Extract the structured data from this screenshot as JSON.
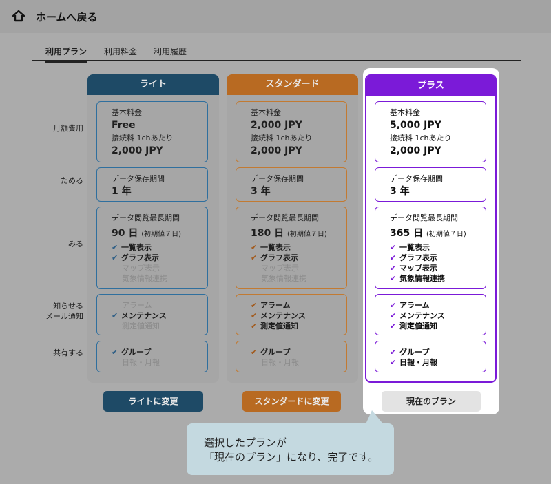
{
  "header": {
    "home_label": "ホームへ戻る"
  },
  "tabs": [
    {
      "label": "利用プラン",
      "active": true
    },
    {
      "label": "利用料金",
      "active": false
    },
    {
      "label": "利用履歴",
      "active": false
    }
  ],
  "row_labels": {
    "monthly_fee": "月額費用",
    "store": "ためる",
    "view": "みる",
    "notify_line1": "知らせる",
    "notify_line2": "メール通知",
    "share": "共有する"
  },
  "common": {
    "base_fee_label": "基本料金",
    "per_channel_label": "接続料 1chあたり",
    "retention_label": "データ保存期間",
    "view_period_label": "データ閲覧最長期間",
    "initial_note": "(初期値７日)"
  },
  "plans": [
    {
      "name": "ライト",
      "base_fee": "Free",
      "per_channel_fee": "2,000 JPY",
      "retention": "1 年",
      "view_period": "90 日",
      "view_features": [
        {
          "label": "一覧表示",
          "enabled": true
        },
        {
          "label": "グラフ表示",
          "enabled": true
        },
        {
          "label": "マップ表示",
          "enabled": false
        },
        {
          "label": "気象情報連携",
          "enabled": false
        }
      ],
      "notify_features": [
        {
          "label": "アラーム",
          "enabled": false
        },
        {
          "label": "メンテナンス",
          "enabled": true
        },
        {
          "label": "測定値通知",
          "enabled": false
        }
      ],
      "share_features": [
        {
          "label": "グループ",
          "enabled": true
        },
        {
          "label": "日報・月報",
          "enabled": false
        }
      ],
      "button_label": "ライトに変更"
    },
    {
      "name": "スタンダード",
      "base_fee": "2,000 JPY",
      "per_channel_fee": "2,000 JPY",
      "retention": "3 年",
      "view_period": "180 日",
      "view_features": [
        {
          "label": "一覧表示",
          "enabled": true
        },
        {
          "label": "グラフ表示",
          "enabled": true
        },
        {
          "label": "マップ表示",
          "enabled": false
        },
        {
          "label": "気象情報連携",
          "enabled": false
        }
      ],
      "notify_features": [
        {
          "label": "アラーム",
          "enabled": true
        },
        {
          "label": "メンテナンス",
          "enabled": true
        },
        {
          "label": "測定値通知",
          "enabled": true
        }
      ],
      "share_features": [
        {
          "label": "グループ",
          "enabled": true
        },
        {
          "label": "日報・月報",
          "enabled": false
        }
      ],
      "button_label": "スタンダードに変更"
    },
    {
      "name": "プラス",
      "base_fee": "5,000 JPY",
      "per_channel_fee": "2,000 JPY",
      "retention": "3 年",
      "view_period": "365 日",
      "view_features": [
        {
          "label": "一覧表示",
          "enabled": true
        },
        {
          "label": "グラフ表示",
          "enabled": true
        },
        {
          "label": "マップ表示",
          "enabled": true
        },
        {
          "label": "気象情報連携",
          "enabled": true
        }
      ],
      "notify_features": [
        {
          "label": "アラーム",
          "enabled": true
        },
        {
          "label": "メンテナンス",
          "enabled": true
        },
        {
          "label": "測定値通知",
          "enabled": true
        }
      ],
      "share_features": [
        {
          "label": "グループ",
          "enabled": true
        },
        {
          "label": "日報・月報",
          "enabled": true
        }
      ],
      "button_label": "現在のプラン"
    }
  ],
  "callout": {
    "line1": "選択したプランが",
    "line2": "「現在のプラン」になり、完了です。"
  },
  "colors": {
    "lite": "#1e4a66",
    "standard": "#b86a22",
    "plus": "#7b1ad8",
    "callout": "#c4d9e0"
  }
}
